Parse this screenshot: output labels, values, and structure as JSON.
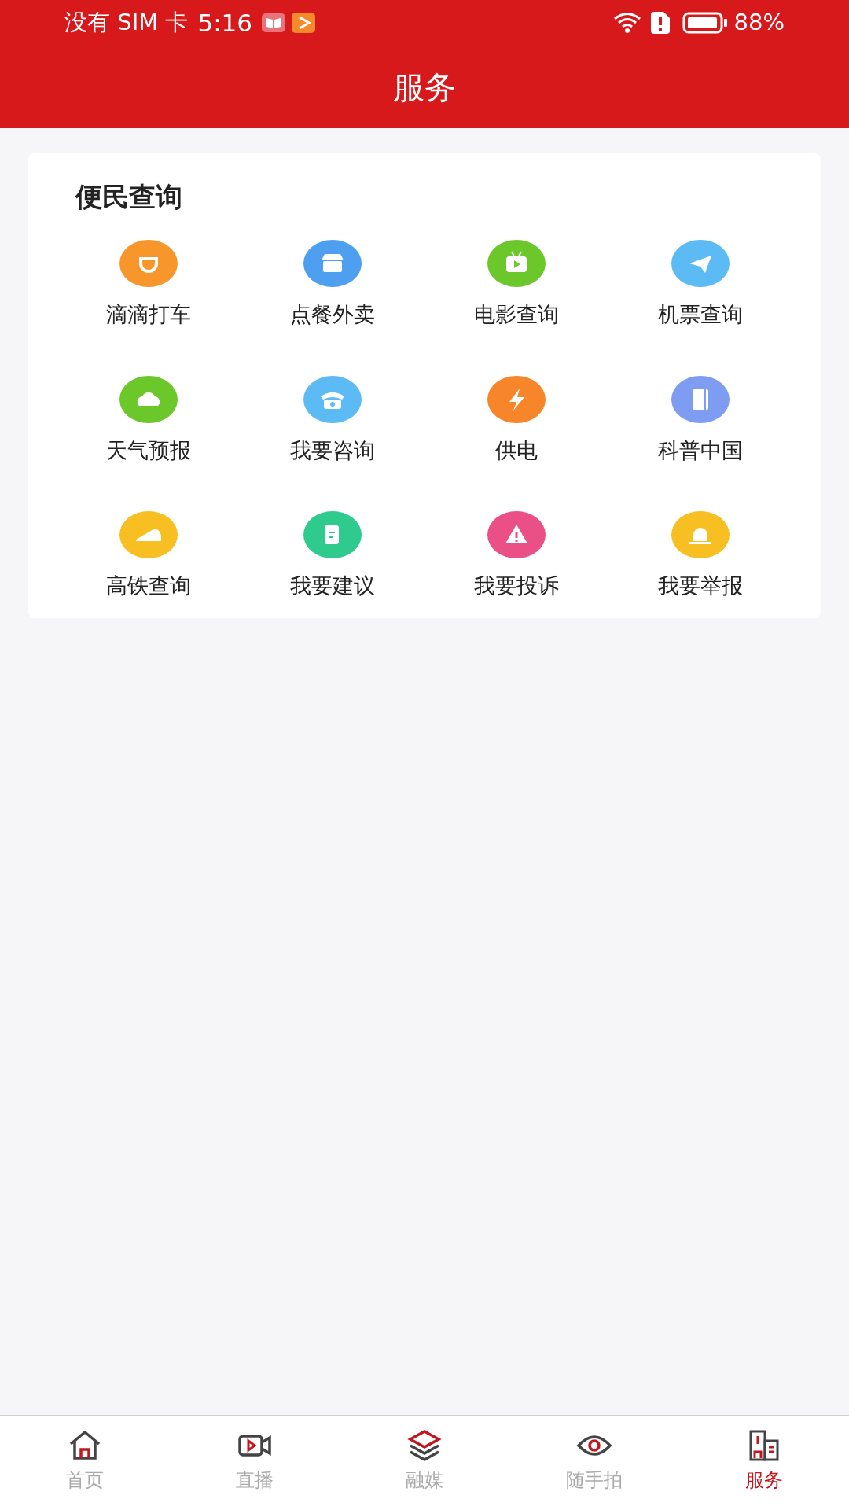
{
  "status_bar": {
    "carrier": "没有 SIM 卡",
    "time": "5:16",
    "battery": "88%"
  },
  "header": {
    "title": "服务"
  },
  "section": {
    "title": "便民查询",
    "items": [
      {
        "label": "滴滴打车",
        "color": "#f7962b"
      },
      {
        "label": "点餐外卖",
        "color": "#4f9ff0"
      },
      {
        "label": "电影查询",
        "color": "#6cc82a"
      },
      {
        "label": "机票查询",
        "color": "#5cbaf5"
      },
      {
        "label": "天气预报",
        "color": "#6cc82a"
      },
      {
        "label": "我要咨询",
        "color": "#5cbaf5"
      },
      {
        "label": "供电",
        "color": "#f7862b"
      },
      {
        "label": "科普中国",
        "color": "#7e9cf2"
      },
      {
        "label": "高铁查询",
        "color": "#f8bf22"
      },
      {
        "label": "我要建议",
        "color": "#2fcb8e"
      },
      {
        "label": "我要投诉",
        "color": "#ea4f85"
      },
      {
        "label": "我要举报",
        "color": "#f8bf22"
      }
    ]
  },
  "tab_bar": [
    {
      "label": "首页",
      "selected": false
    },
    {
      "label": "直播",
      "selected": false
    },
    {
      "label": "融媒",
      "selected": false
    },
    {
      "label": "随手拍",
      "selected": false
    },
    {
      "label": "服务",
      "selected": true
    }
  ]
}
